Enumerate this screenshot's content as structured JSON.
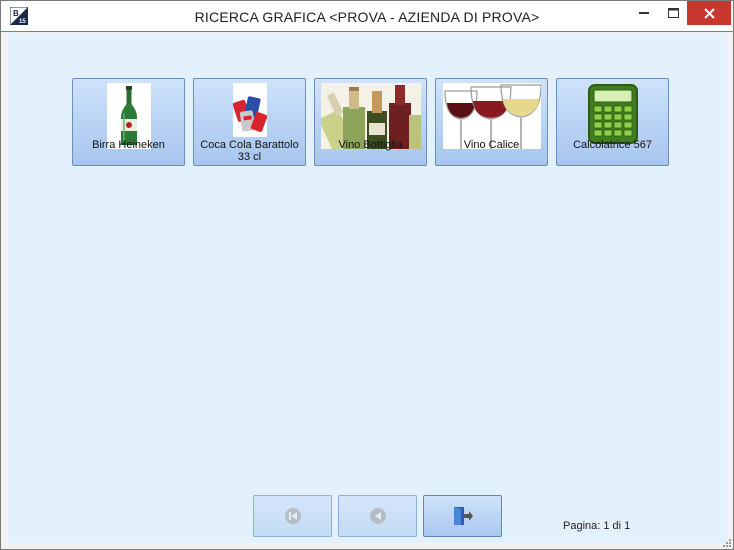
{
  "window": {
    "title": "RICERCA GRAFICA <PROVA - AZIENDA DI PROVA>",
    "icon_label": "B",
    "icon_sublabel": "15"
  },
  "tiles": [
    {
      "label": "Birra Heineken",
      "icon": "beer-bottle-image"
    },
    {
      "label": "Coca Cola Barattolo 33 cl",
      "icon": "cola-cans-image"
    },
    {
      "label": "Vino Bottiglia",
      "icon": "wine-bottles-image"
    },
    {
      "label": "Vino Calice",
      "icon": "wine-glasses-image"
    },
    {
      "label": "Calcolatrice 567",
      "icon": "calculator-image"
    }
  ],
  "pagination": {
    "label": "Pagina: 1 di 1",
    "current_page": 1,
    "total_pages": 1
  },
  "colors": {
    "client_background": "#e3f1fd",
    "tile_gradient_top": "#cfe3fa",
    "tile_gradient_bottom": "#a8c6ee",
    "close_button": "#c7372f"
  }
}
